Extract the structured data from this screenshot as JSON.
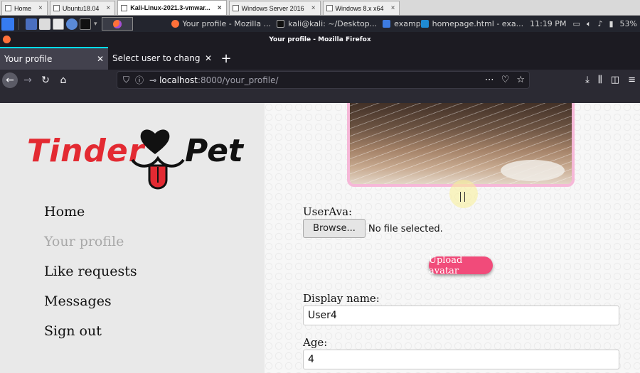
{
  "vm_tabs": [
    {
      "label": "Home"
    },
    {
      "label": "Ubuntu18.04"
    },
    {
      "label": "Kali-Linux-2021.3-vmwar..."
    },
    {
      "label": "Windows Server 2016"
    },
    {
      "label": "Windows 8.x x64"
    }
  ],
  "panel": {
    "task_firefox": "Your profile - Mozilla ...",
    "task_terminal": "kali@kali: ~/Desktop...",
    "task_folder": "example",
    "task_vscode": "homepage.html - exa...",
    "clock": "11:19 PM",
    "battery": "53%"
  },
  "window_title": "Your profile - Mozilla Firefox",
  "tabs": [
    {
      "label": "Your profile",
      "active": true
    },
    {
      "label": "Select user to change | Djang",
      "active": false
    }
  ],
  "url": {
    "host": "localhost",
    "path": ":8000/your_profile/"
  },
  "logo": {
    "word1": "Tinder",
    "word2": "Pet"
  },
  "menu": [
    {
      "label": "Home",
      "active": false
    },
    {
      "label": "Your profile",
      "active": true
    },
    {
      "label": "Like requests",
      "active": false
    },
    {
      "label": "Messages",
      "active": false
    },
    {
      "label": "Sign out",
      "active": false
    }
  ],
  "form": {
    "ava_label": "UserAva:",
    "browse_label": "Browse...",
    "file_status": "No file selected.",
    "upload_label": "Upload avatar",
    "display_name_label": "Display name:",
    "display_name_value": "User4",
    "age_label": "Age:",
    "age_value": "4"
  },
  "colors": {
    "accent": "#f14b7a",
    "frame": "#f6b8d8",
    "brand_red": "#e32a32"
  }
}
